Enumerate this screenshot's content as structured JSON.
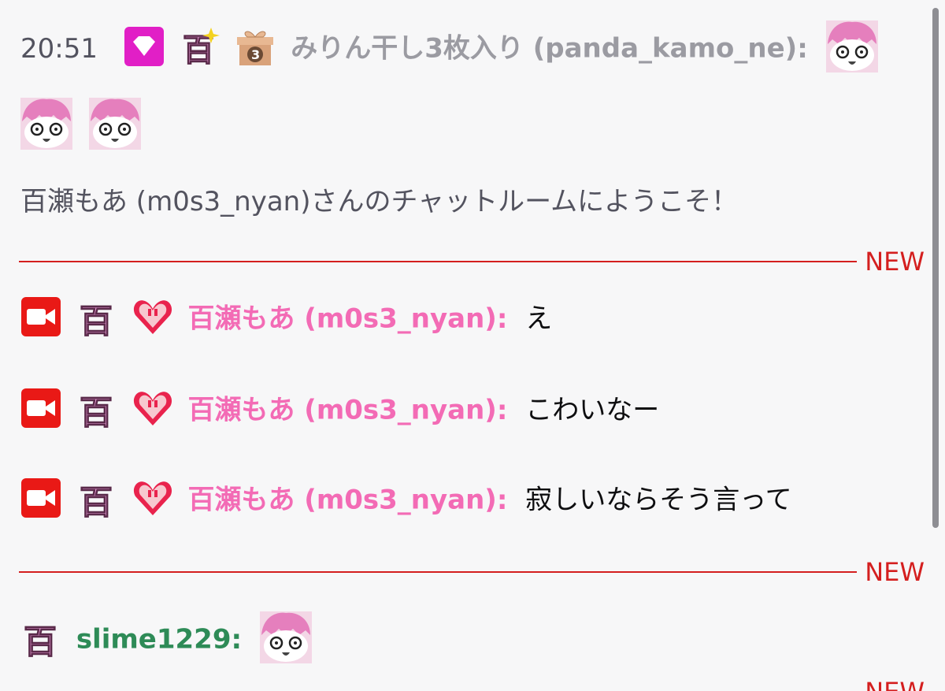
{
  "messages": [
    {
      "time": "20:51",
      "badges": [
        "diamond-badge",
        "momo-sparkle-badge",
        "gift-3-badge"
      ],
      "username": "みりん干し3枚入り (panda_kamo_ne)",
      "colon": ":",
      "emotes": [
        "surprised-girl-emote",
        "surprised-girl-emote",
        "surprised-girl-emote"
      ]
    },
    {
      "system_text": "百瀬もあ (m0s3_nyan)さんのチャットルームにようこそ！"
    },
    {
      "badges": [
        "broadcaster-badge",
        "momo-badge",
        "heart-badge"
      ],
      "username": "百瀬もあ (m0s3_nyan)",
      "colon": ":",
      "text": "え"
    },
    {
      "badges": [
        "broadcaster-badge",
        "momo-badge",
        "heart-badge"
      ],
      "username": "百瀬もあ (m0s3_nyan)",
      "colon": ":",
      "text": "こわいなー"
    },
    {
      "badges": [
        "broadcaster-badge",
        "momo-badge",
        "heart-badge"
      ],
      "username": "百瀬もあ (m0s3_nyan)",
      "colon": ":",
      "text": "寂しいならそう言って"
    },
    {
      "badges": [
        "momo-badge"
      ],
      "username": "slime1229",
      "colon": ":",
      "emotes": [
        "surprised-girl-emote"
      ]
    }
  ],
  "dividers": [
    {
      "label": "NEW"
    },
    {
      "label": "NEW"
    },
    {
      "label": "NEW"
    }
  ],
  "colors": {
    "accent_new": "#d41f1f",
    "username_gray": "#9b9ba2",
    "username_pink": "#f36bb5",
    "username_green": "#2e8b57",
    "background": "#f7f7f8"
  }
}
